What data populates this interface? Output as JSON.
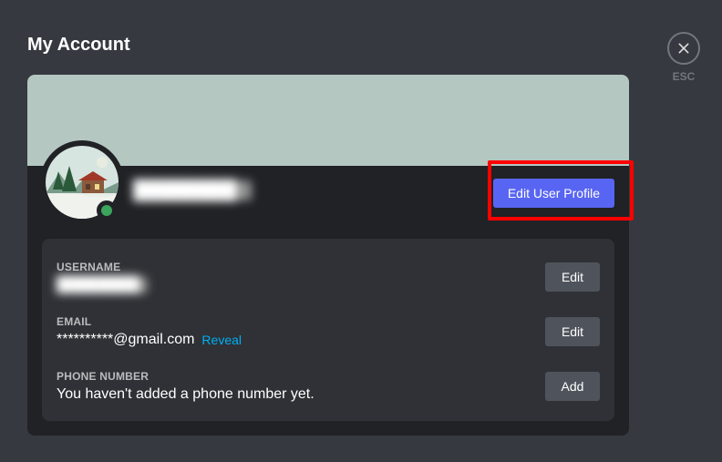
{
  "page": {
    "title": "My Account",
    "escLabel": "ESC"
  },
  "profile": {
    "username": "████████",
    "editProfileLabel": "Edit User Profile",
    "status": "online"
  },
  "fields": {
    "username": {
      "label": "USERNAME",
      "value": "████████",
      "buttonLabel": "Edit"
    },
    "email": {
      "label": "EMAIL",
      "value": "**********@gmail.com",
      "revealLabel": "Reveal",
      "buttonLabel": "Edit"
    },
    "phone": {
      "label": "PHONE NUMBER",
      "value": "You haven't added a phone number yet.",
      "buttonLabel": "Add"
    }
  },
  "colors": {
    "accent": "#5865f2",
    "banner": "#b4c7c1",
    "statusOnline": "#3ba55d",
    "highlightBorder": "#ff0000"
  }
}
